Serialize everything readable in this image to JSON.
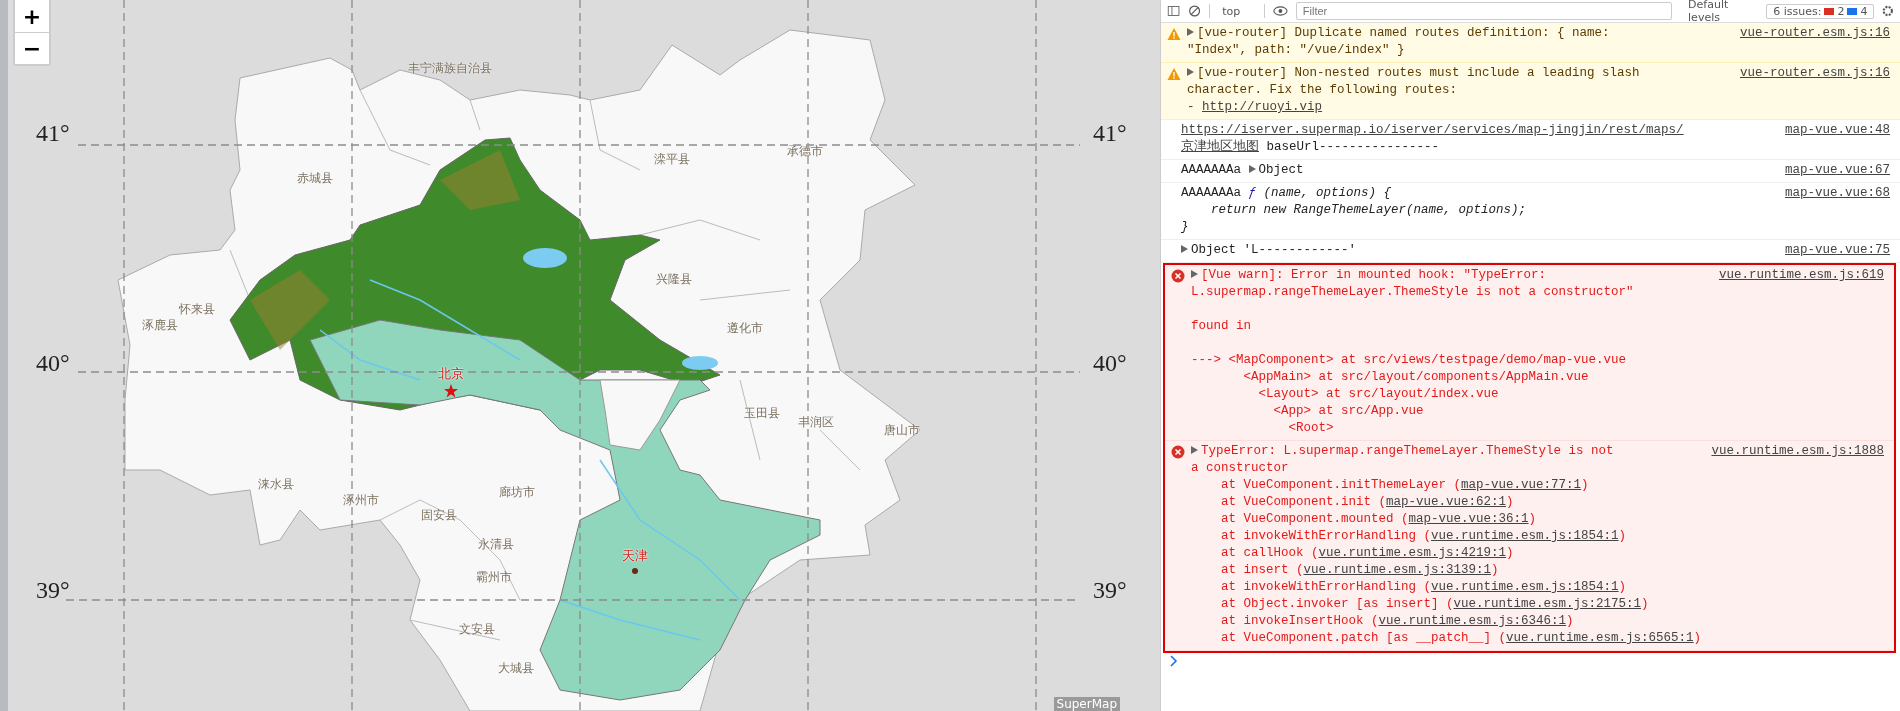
{
  "map": {
    "zoom_controls": [
      "+",
      "−"
    ],
    "latitude_labels": [
      "41°",
      "41°",
      "40°",
      "40°",
      "39°",
      "39°"
    ],
    "place_labels": [
      {
        "text": "丰宁满族自治县",
        "kind": "county"
      },
      {
        "text": "滦平县",
        "kind": "county"
      },
      {
        "text": "承德市",
        "kind": "county"
      },
      {
        "text": "赤城县",
        "kind": "county"
      },
      {
        "text": "兴隆县",
        "kind": "county"
      },
      {
        "text": "怀来县",
        "kind": "county"
      },
      {
        "text": "涿鹿县",
        "kind": "county"
      },
      {
        "text": "遵化市",
        "kind": "county"
      },
      {
        "text": "北京",
        "kind": "capital"
      },
      {
        "text": "玉田县",
        "kind": "county"
      },
      {
        "text": "丰润区",
        "kind": "county"
      },
      {
        "text": "唐山市",
        "kind": "county"
      },
      {
        "text": "涞水县",
        "kind": "county"
      },
      {
        "text": "涿州市",
        "kind": "county"
      },
      {
        "text": "廊坊市",
        "kind": "county"
      },
      {
        "text": "固安县",
        "kind": "county"
      },
      {
        "text": "永清县",
        "kind": "county"
      },
      {
        "text": "天津",
        "kind": "city"
      },
      {
        "text": "霸州市",
        "kind": "county"
      },
      {
        "text": "文安县",
        "kind": "county"
      },
      {
        "text": "大城县",
        "kind": "county"
      }
    ],
    "attribution": "SuperMap"
  },
  "console": {
    "toolbar": {
      "context": "top",
      "filter_placeholder": "Filter",
      "levels": "Default levels",
      "issues_label": "6 issues:",
      "error_count": "2",
      "info_count": "4"
    },
    "messages": [
      {
        "kind": "warning",
        "expandable": true,
        "highlighted": false,
        "source": "vue-router.esm.js:16",
        "paragraphs": [
          [
            [
              "[vue-router] Duplicate named routes definition: { name:"
            ],
            [
              "\"Index\", path: \"/vue/index\" }"
            ]
          ]
        ]
      },
      {
        "kind": "warning",
        "expandable": true,
        "highlighted": false,
        "source": "vue-router.esm.js:16",
        "paragraphs": [
          [
            [
              "[vue-router] Non-nested routes must include a leading slash"
            ],
            [
              "character. Fix the following routes:"
            ],
            [
              "- ",
              {
                "text": "http://ruoyi.vip",
                "kind": "link"
              }
            ]
          ]
        ]
      },
      {
        "kind": "log",
        "expandable": false,
        "highlighted": false,
        "source": "map-vue.vue:48",
        "paragraphs": [
          [
            [
              {
                "text": "https://iserver.supermap.io/iserver/services/map-jingjin/rest/maps/",
                "kind": "link"
              }
            ],
            [
              {
                "text": "京津地区地图",
                "kind": "link"
              },
              " baseUrl----------------"
            ]
          ]
        ]
      },
      {
        "kind": "log",
        "expandable": false,
        "highlighted": false,
        "source": "map-vue.vue:67",
        "paragraphs": [
          [
            [
              "AAAAAAAa ",
              {
                "text": "Object",
                "kind": "object"
              }
            ]
          ]
        ]
      },
      {
        "kind": "log",
        "expandable": false,
        "highlighted": false,
        "source": "map-vue.vue:68",
        "paragraphs": [
          [
            [
              "AAAAAAAa ",
              {
                "text": "ƒ",
                "kind": "fn"
              },
              {
                "text": " (name, options) {",
                "kind": "code"
              }
            ],
            [
              {
                "text": "    return new RangeThemeLayer(name, options);",
                "kind": "code"
              }
            ],
            [
              {
                "text": "}",
                "kind": "code"
              }
            ]
          ]
        ]
      },
      {
        "kind": "log",
        "expandable": true,
        "highlighted": false,
        "source": "map-vue.vue:75",
        "paragraphs": [
          [
            [
              "Object 'L------------'"
            ]
          ]
        ]
      },
      {
        "kind": "error",
        "expandable": true,
        "highlighted": true,
        "source": "vue.runtime.esm.js:619",
        "paragraphs": [
          [
            [
              "[Vue warn]: Error in mounted hook: \"TypeError:"
            ],
            [
              "L.supermap.rangeThemeLayer.ThemeStyle is not a constructor\""
            ]
          ],
          [
            [
              "found in"
            ]
          ],
          [
            [
              "---> <MapComponent> at src/views/testpage/demo/map-vue.vue"
            ],
            [
              "       <AppMain> at src/layout/components/AppMain.vue"
            ],
            [
              "         <Layout> at src/layout/index.vue"
            ],
            [
              "           <App> at src/App.vue"
            ],
            [
              "             <Root>"
            ]
          ]
        ]
      },
      {
        "kind": "error",
        "expandable": true,
        "highlighted": true,
        "source": "vue.runtime.esm.js:1888",
        "paragraphs": [
          [
            [
              "TypeError: L.supermap.rangeThemeLayer.ThemeStyle is not"
            ],
            [
              "a constructor"
            ],
            [
              "    at VueComponent.initThemeLayer (",
              {
                "text": "map-vue.vue:77:1",
                "kind": "link"
              },
              ")"
            ],
            [
              "    at VueComponent.init (",
              {
                "text": "map-vue.vue:62:1",
                "kind": "link"
              },
              ")"
            ],
            [
              "    at VueComponent.mounted (",
              {
                "text": "map-vue.vue:36:1",
                "kind": "link"
              },
              ")"
            ],
            [
              "    at invokeWithErrorHandling (",
              {
                "text": "vue.runtime.esm.js:1854:1",
                "kind": "link"
              },
              ")"
            ],
            [
              "    at callHook (",
              {
                "text": "vue.runtime.esm.js:4219:1",
                "kind": "link"
              },
              ")"
            ],
            [
              "    at insert (",
              {
                "text": "vue.runtime.esm.js:3139:1",
                "kind": "link"
              },
              ")"
            ],
            [
              "    at invokeWithErrorHandling (",
              {
                "text": "vue.runtime.esm.js:1854:1",
                "kind": "link"
              },
              ")"
            ],
            [
              "    at Object.invoker [as insert] (",
              {
                "text": "vue.runtime.esm.js:2175:1",
                "kind": "link"
              },
              ")"
            ],
            [
              "    at invokeInsertHook (",
              {
                "text": "vue.runtime.esm.js:6346:1",
                "kind": "link"
              },
              ")"
            ],
            [
              "    at VueComponent.patch [as __patch__] (",
              {
                "text": "vue.runtime.esm.js:6565:1",
                "kind": "link"
              },
              ")"
            ]
          ]
        ]
      }
    ]
  }
}
